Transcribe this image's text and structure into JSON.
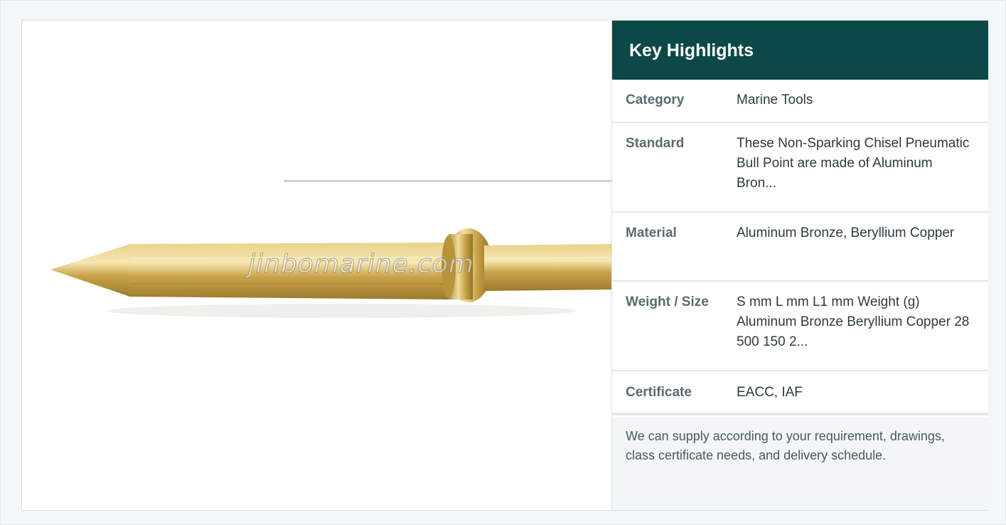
{
  "image": {
    "watermark": "jinbomarine.com",
    "alt": "Non-Sparking Chisel Pneumatic Bull Point"
  },
  "highlights": {
    "title": "Key Highlights",
    "rows": [
      {
        "key": "Category",
        "value": "Marine Tools"
      },
      {
        "key": "Standard",
        "value": "These Non-Sparking Chisel Pneumatic Bull Point are made of Aluminum Bron..."
      },
      {
        "key": "Material",
        "value": "Aluminum Bronze, Beryllium Copper"
      },
      {
        "key": "Weight / Size",
        "value": "S mm L mm L1 mm Weight (g) Aluminum Bronze Beryllium Copper 28 500 150 2..."
      },
      {
        "key": "Certificate",
        "value": "EACC, IAF"
      }
    ],
    "note": "We can supply according to your requirement, drawings, class certificate needs, and delivery schedule."
  },
  "colors": {
    "header_bg": "#0d4848",
    "page_bg": "#f3f7f7",
    "bronze": "#c9a44a"
  }
}
